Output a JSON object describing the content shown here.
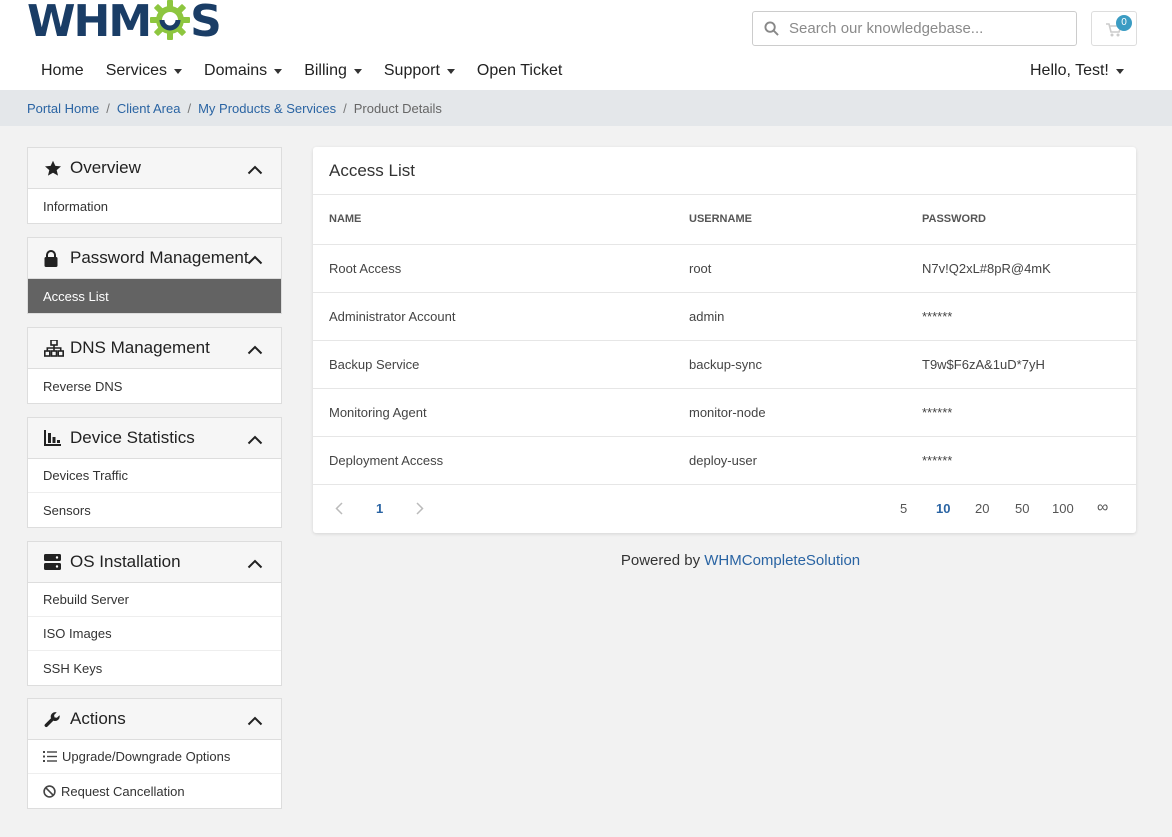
{
  "brand": {
    "logo_text_left": "WHM",
    "logo_text_right": "S",
    "accent": "#1a3d66",
    "gear_color": "#8dc63f"
  },
  "search": {
    "placeholder": "Search our knowledgebase..."
  },
  "cart": {
    "count": "0"
  },
  "nav": {
    "items": [
      {
        "label": "Home",
        "has_caret": false
      },
      {
        "label": "Services",
        "has_caret": true
      },
      {
        "label": "Domains",
        "has_caret": true
      },
      {
        "label": "Billing",
        "has_caret": true
      },
      {
        "label": "Support",
        "has_caret": true
      },
      {
        "label": "Open Ticket",
        "has_caret": false
      }
    ],
    "user_menu": "Hello, Test!"
  },
  "breadcrumb": {
    "items": [
      "Portal Home",
      "Client Area",
      "My Products & Services"
    ],
    "current": "Product Details"
  },
  "sidebar": {
    "panels": [
      {
        "title": "Overview",
        "icon": "star-icon",
        "items": [
          {
            "label": "Information"
          }
        ]
      },
      {
        "title": "Password Management",
        "icon": "lock-icon",
        "items": [
          {
            "label": "Access List",
            "active": true
          }
        ]
      },
      {
        "title": "DNS Management",
        "icon": "sitemap-icon",
        "items": [
          {
            "label": "Reverse DNS"
          }
        ]
      },
      {
        "title": "Device Statistics",
        "icon": "chart-icon",
        "items": [
          {
            "label": "Devices Traffic"
          },
          {
            "label": "Sensors"
          }
        ]
      },
      {
        "title": "OS Installation",
        "icon": "server-icon",
        "items": [
          {
            "label": "Rebuild Server"
          },
          {
            "label": "ISO Images"
          },
          {
            "label": "SSH Keys"
          }
        ]
      },
      {
        "title": "Actions",
        "icon": "wrench-icon",
        "items": [
          {
            "label": "Upgrade/Downgrade Options",
            "icon": "list-icon"
          },
          {
            "label": "Request Cancellation",
            "icon": "ban-icon"
          }
        ]
      }
    ]
  },
  "access_list": {
    "title": "Access List",
    "columns": [
      "NAME",
      "USERNAME",
      "PASSWORD"
    ],
    "rows": [
      {
        "name": "Root Access",
        "username": "root",
        "password": "N7v!Q2xL#8pR@4mK"
      },
      {
        "name": "Administrator Account",
        "username": "admin",
        "password": "******"
      },
      {
        "name": "Backup Service",
        "username": "backup-sync",
        "password": "T9w$F6zA&1uD*7yH"
      },
      {
        "name": "Monitoring Agent",
        "username": "monitor-node",
        "password": "******"
      },
      {
        "name": "Deployment Access",
        "username": "deploy-user",
        "password": "******"
      }
    ],
    "pagination": {
      "current_page": "1",
      "page_sizes": [
        "5",
        "10",
        "20",
        "50",
        "100",
        "∞"
      ],
      "selected_size": "10"
    }
  },
  "footer": {
    "prefix": "Powered by ",
    "link": "WHMCompleteSolution"
  }
}
